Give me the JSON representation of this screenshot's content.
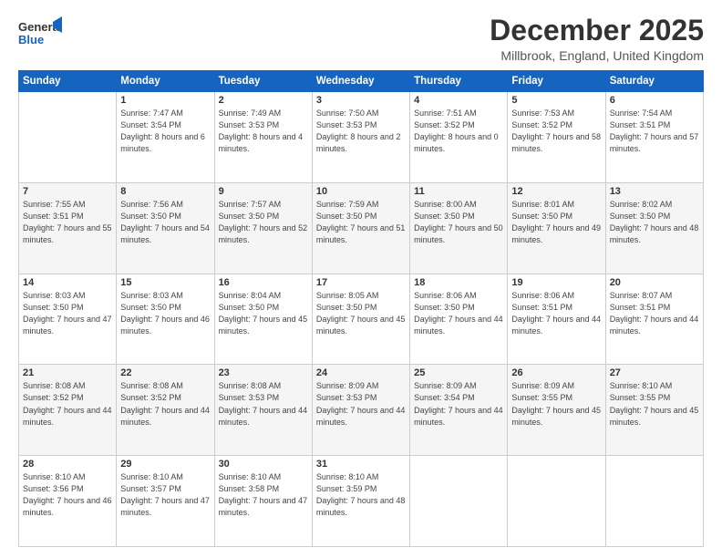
{
  "logo": {
    "general": "General",
    "blue": "Blue"
  },
  "header": {
    "month": "December 2025",
    "location": "Millbrook, England, United Kingdom"
  },
  "weekdays": [
    "Sunday",
    "Monday",
    "Tuesday",
    "Wednesday",
    "Thursday",
    "Friday",
    "Saturday"
  ],
  "weeks": [
    [
      {
        "day": "",
        "sunrise": "",
        "sunset": "",
        "daylight": ""
      },
      {
        "day": "1",
        "sunrise": "Sunrise: 7:47 AM",
        "sunset": "Sunset: 3:54 PM",
        "daylight": "Daylight: 8 hours and 6 minutes."
      },
      {
        "day": "2",
        "sunrise": "Sunrise: 7:49 AM",
        "sunset": "Sunset: 3:53 PM",
        "daylight": "Daylight: 8 hours and 4 minutes."
      },
      {
        "day": "3",
        "sunrise": "Sunrise: 7:50 AM",
        "sunset": "Sunset: 3:53 PM",
        "daylight": "Daylight: 8 hours and 2 minutes."
      },
      {
        "day": "4",
        "sunrise": "Sunrise: 7:51 AM",
        "sunset": "Sunset: 3:52 PM",
        "daylight": "Daylight: 8 hours and 0 minutes."
      },
      {
        "day": "5",
        "sunrise": "Sunrise: 7:53 AM",
        "sunset": "Sunset: 3:52 PM",
        "daylight": "Daylight: 7 hours and 58 minutes."
      },
      {
        "day": "6",
        "sunrise": "Sunrise: 7:54 AM",
        "sunset": "Sunset: 3:51 PM",
        "daylight": "Daylight: 7 hours and 57 minutes."
      }
    ],
    [
      {
        "day": "7",
        "sunrise": "Sunrise: 7:55 AM",
        "sunset": "Sunset: 3:51 PM",
        "daylight": "Daylight: 7 hours and 55 minutes."
      },
      {
        "day": "8",
        "sunrise": "Sunrise: 7:56 AM",
        "sunset": "Sunset: 3:50 PM",
        "daylight": "Daylight: 7 hours and 54 minutes."
      },
      {
        "day": "9",
        "sunrise": "Sunrise: 7:57 AM",
        "sunset": "Sunset: 3:50 PM",
        "daylight": "Daylight: 7 hours and 52 minutes."
      },
      {
        "day": "10",
        "sunrise": "Sunrise: 7:59 AM",
        "sunset": "Sunset: 3:50 PM",
        "daylight": "Daylight: 7 hours and 51 minutes."
      },
      {
        "day": "11",
        "sunrise": "Sunrise: 8:00 AM",
        "sunset": "Sunset: 3:50 PM",
        "daylight": "Daylight: 7 hours and 50 minutes."
      },
      {
        "day": "12",
        "sunrise": "Sunrise: 8:01 AM",
        "sunset": "Sunset: 3:50 PM",
        "daylight": "Daylight: 7 hours and 49 minutes."
      },
      {
        "day": "13",
        "sunrise": "Sunrise: 8:02 AM",
        "sunset": "Sunset: 3:50 PM",
        "daylight": "Daylight: 7 hours and 48 minutes."
      }
    ],
    [
      {
        "day": "14",
        "sunrise": "Sunrise: 8:03 AM",
        "sunset": "Sunset: 3:50 PM",
        "daylight": "Daylight: 7 hours and 47 minutes."
      },
      {
        "day": "15",
        "sunrise": "Sunrise: 8:03 AM",
        "sunset": "Sunset: 3:50 PM",
        "daylight": "Daylight: 7 hours and 46 minutes."
      },
      {
        "day": "16",
        "sunrise": "Sunrise: 8:04 AM",
        "sunset": "Sunset: 3:50 PM",
        "daylight": "Daylight: 7 hours and 45 minutes."
      },
      {
        "day": "17",
        "sunrise": "Sunrise: 8:05 AM",
        "sunset": "Sunset: 3:50 PM",
        "daylight": "Daylight: 7 hours and 45 minutes."
      },
      {
        "day": "18",
        "sunrise": "Sunrise: 8:06 AM",
        "sunset": "Sunset: 3:50 PM",
        "daylight": "Daylight: 7 hours and 44 minutes."
      },
      {
        "day": "19",
        "sunrise": "Sunrise: 8:06 AM",
        "sunset": "Sunset: 3:51 PM",
        "daylight": "Daylight: 7 hours and 44 minutes."
      },
      {
        "day": "20",
        "sunrise": "Sunrise: 8:07 AM",
        "sunset": "Sunset: 3:51 PM",
        "daylight": "Daylight: 7 hours and 44 minutes."
      }
    ],
    [
      {
        "day": "21",
        "sunrise": "Sunrise: 8:08 AM",
        "sunset": "Sunset: 3:52 PM",
        "daylight": "Daylight: 7 hours and 44 minutes."
      },
      {
        "day": "22",
        "sunrise": "Sunrise: 8:08 AM",
        "sunset": "Sunset: 3:52 PM",
        "daylight": "Daylight: 7 hours and 44 minutes."
      },
      {
        "day": "23",
        "sunrise": "Sunrise: 8:08 AM",
        "sunset": "Sunset: 3:53 PM",
        "daylight": "Daylight: 7 hours and 44 minutes."
      },
      {
        "day": "24",
        "sunrise": "Sunrise: 8:09 AM",
        "sunset": "Sunset: 3:53 PM",
        "daylight": "Daylight: 7 hours and 44 minutes."
      },
      {
        "day": "25",
        "sunrise": "Sunrise: 8:09 AM",
        "sunset": "Sunset: 3:54 PM",
        "daylight": "Daylight: 7 hours and 44 minutes."
      },
      {
        "day": "26",
        "sunrise": "Sunrise: 8:09 AM",
        "sunset": "Sunset: 3:55 PM",
        "daylight": "Daylight: 7 hours and 45 minutes."
      },
      {
        "day": "27",
        "sunrise": "Sunrise: 8:10 AM",
        "sunset": "Sunset: 3:55 PM",
        "daylight": "Daylight: 7 hours and 45 minutes."
      }
    ],
    [
      {
        "day": "28",
        "sunrise": "Sunrise: 8:10 AM",
        "sunset": "Sunset: 3:56 PM",
        "daylight": "Daylight: 7 hours and 46 minutes."
      },
      {
        "day": "29",
        "sunrise": "Sunrise: 8:10 AM",
        "sunset": "Sunset: 3:57 PM",
        "daylight": "Daylight: 7 hours and 47 minutes."
      },
      {
        "day": "30",
        "sunrise": "Sunrise: 8:10 AM",
        "sunset": "Sunset: 3:58 PM",
        "daylight": "Daylight: 7 hours and 47 minutes."
      },
      {
        "day": "31",
        "sunrise": "Sunrise: 8:10 AM",
        "sunset": "Sunset: 3:59 PM",
        "daylight": "Daylight: 7 hours and 48 minutes."
      },
      {
        "day": "",
        "sunrise": "",
        "sunset": "",
        "daylight": ""
      },
      {
        "day": "",
        "sunrise": "",
        "sunset": "",
        "daylight": ""
      },
      {
        "day": "",
        "sunrise": "",
        "sunset": "",
        "daylight": ""
      }
    ]
  ]
}
